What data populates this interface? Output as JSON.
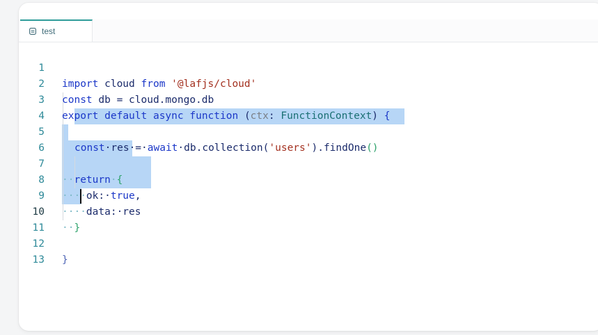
{
  "tab": {
    "label": "test",
    "icon": "file-code-icon"
  },
  "editor": {
    "active_line": 10,
    "lines": [
      {
        "num": "1"
      },
      {
        "num": "2"
      },
      {
        "num": "3"
      },
      {
        "num": "4"
      },
      {
        "num": "5"
      },
      {
        "num": "6"
      },
      {
        "num": "7"
      },
      {
        "num": "8"
      },
      {
        "num": "9"
      },
      {
        "num": "10"
      },
      {
        "num": "11"
      },
      {
        "num": "12"
      },
      {
        "num": "13"
      }
    ],
    "tokens": {
      "l1": [
        "import",
        " cloud ",
        "from",
        " ",
        "'@lafjs/cloud'"
      ],
      "l2": [
        "const",
        " db = cloud.mongo.db"
      ],
      "l3": [
        "export",
        " ",
        "default",
        " ",
        "async",
        " ",
        "function",
        " ",
        "(",
        "ctx",
        ": ",
        "FunctionContext",
        ")",
        " ",
        "{"
      ],
      "l5": [
        "const",
        "·res·=·",
        "await",
        "·db.collection(",
        "'users'",
        ").findOne",
        "()"
      ],
      "l7": [
        "··",
        "return",
        "·",
        "{"
      ],
      "l8": [
        "····",
        "ok:·",
        "true",
        ","
      ],
      "l9": [
        "····",
        "data:·res"
      ],
      "l10": [
        "··",
        "}"
      ],
      "l12": [
        "}"
      ]
    }
  },
  "colors": {
    "selection": "#b7d6f6",
    "keyword": "#1b37c8",
    "string": "#a3301f",
    "type": "#1a6f73",
    "line_number": "#2f8a99",
    "tab_accent": "#2e9c9a"
  }
}
